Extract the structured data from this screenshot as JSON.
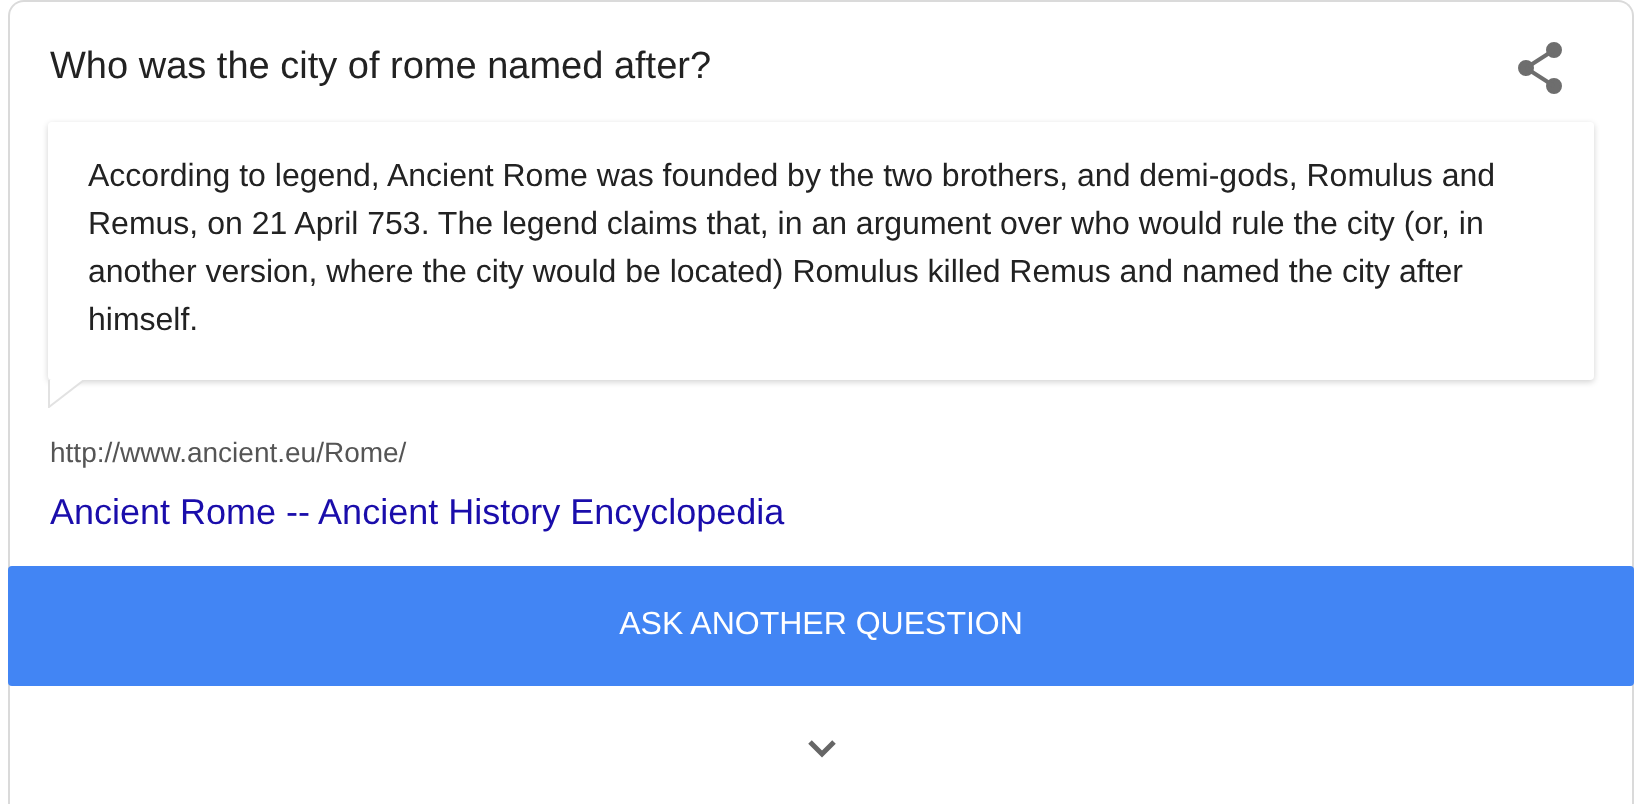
{
  "question": "Who was the city of rome named after?",
  "answer": "According to legend, Ancient Rome was founded by the two brothers, and demi-gods, Romulus and Remus, on 21 April 753. The legend claims that, in an argument over who would rule the city (or, in another version, where the city would be located) Romulus killed Remus and named the city after himself.",
  "source_url": "http://www.ancient.eu/Rome/",
  "source_title": "Ancient Rome -- Ancient History Encyclopedia",
  "button": "ASK ANOTHER QUESTION"
}
